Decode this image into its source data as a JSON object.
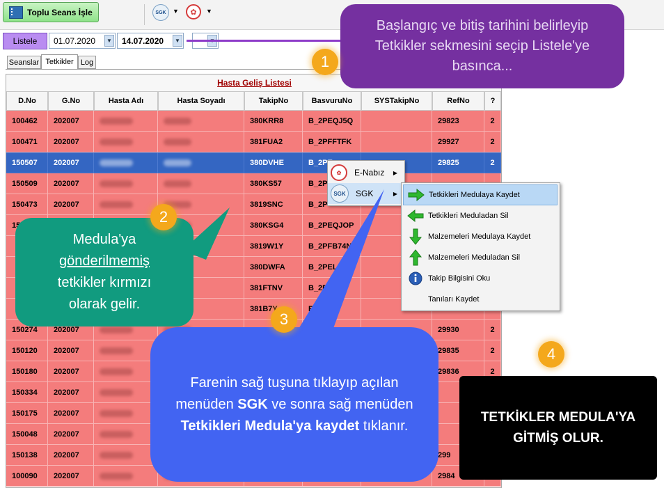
{
  "toolbar": {
    "toplu_label": "Toplu Seans İşle",
    "sgk_icon_text": "SGK"
  },
  "filter": {
    "list_button": "Listele",
    "start_date": "01.07.2020",
    "end_date": "14.07.2020"
  },
  "tabs": [
    {
      "label": "Seanslar",
      "active": false
    },
    {
      "label": "Tetkikler",
      "active": true
    },
    {
      "label": "Log",
      "active": false
    }
  ],
  "grid": {
    "title": "Hasta Geliş Listesi",
    "columns": [
      "D.No",
      "G.No",
      "Hasta Adı",
      "Hasta Soyadı",
      "TakipNo",
      "BasvuruNo",
      "SYSTakipNo",
      "RefNo",
      "?"
    ],
    "rows": [
      {
        "dno": "100462",
        "gno": "202007",
        "takip": "380KRR8",
        "basvuru": "B_2PEQJ5Q",
        "sys": "",
        "ref": "29823",
        "q": "2",
        "selected": false
      },
      {
        "dno": "100471",
        "gno": "202007",
        "takip": "381FUA2",
        "basvuru": "B_2PFFTFK",
        "sys": "",
        "ref": "29927",
        "q": "2",
        "selected": false
      },
      {
        "dno": "150507",
        "gno": "202007",
        "takip": "380DVHE",
        "basvuru": "B_2PE",
        "sys": "",
        "ref": "29825",
        "q": "2",
        "selected": true
      },
      {
        "dno": "150509",
        "gno": "202007",
        "takip": "380KS57",
        "basvuru": "B_2P",
        "sys": "",
        "ref": "",
        "q": "",
        "selected": false
      },
      {
        "dno": "150473",
        "gno": "202007",
        "takip": "3819SNC",
        "basvuru": "B_2P",
        "sys": "",
        "ref": "",
        "q": "",
        "selected": false
      },
      {
        "dno": "15",
        "gno": "",
        "takip": "380KSG4",
        "basvuru": "B_2PEQJOP",
        "sys": "",
        "ref": "",
        "q": "",
        "selected": false
      },
      {
        "dno": "",
        "gno": "",
        "takip": "3819W1Y",
        "basvuru": "B_2PFB74N",
        "sys": "",
        "ref": "",
        "q": "",
        "selected": false
      },
      {
        "dno": "",
        "gno": "",
        "takip": "380DWFA",
        "basvuru": "B_2PEL6T8",
        "sys": "",
        "ref": "",
        "q": "",
        "selected": false
      },
      {
        "dno": "",
        "gno": "",
        "takip": "381FTNV",
        "basvuru": "B_2PFFS",
        "sys": "",
        "ref": "",
        "q": "",
        "selected": false
      },
      {
        "dno": "",
        "gno": "",
        "takip": "381B7Y",
        "basvuru": "B_2PF",
        "sys": "",
        "ref": "",
        "q": "",
        "selected": false
      },
      {
        "dno": "150274",
        "gno": "202007",
        "takip": "",
        "basvuru": "",
        "sys": "",
        "ref": "29930",
        "q": "2",
        "selected": false
      },
      {
        "dno": "150120",
        "gno": "202007",
        "takip": "",
        "basvuru": "",
        "sys": "",
        "ref": "29835",
        "q": "2",
        "selected": false
      },
      {
        "dno": "150180",
        "gno": "202007",
        "takip": "",
        "basvuru": "",
        "sys": "",
        "ref": "29836",
        "q": "2",
        "selected": false
      },
      {
        "dno": "150334",
        "gno": "202007",
        "takip": "",
        "basvuru": "",
        "sys": "",
        "ref": "",
        "q": "",
        "selected": false
      },
      {
        "dno": "150175",
        "gno": "202007",
        "takip": "",
        "basvuru": "",
        "sys": "",
        "ref": "",
        "q": "",
        "selected": false
      },
      {
        "dno": "150048",
        "gno": "202007",
        "takip": "",
        "basvuru": "",
        "sys": "",
        "ref": "",
        "q": "",
        "selected": false
      },
      {
        "dno": "150138",
        "gno": "202007",
        "takip": "",
        "basvuru": "",
        "sys": "",
        "ref": "299",
        "q": "",
        "selected": false
      },
      {
        "dno": "100090",
        "gno": "202007",
        "takip": "",
        "basvuru": "",
        "sys": "",
        "ref": "2984",
        "q": "",
        "selected": false
      }
    ]
  },
  "context_menu": {
    "items": [
      {
        "label": "E-Nabız",
        "icon": "enabiz-icon"
      },
      {
        "label": "SGK",
        "icon": "sgk-icon"
      }
    ],
    "submenu": [
      {
        "label": "Tetkikleri Medulaya Kaydet",
        "icon": "green-right-arrow-icon",
        "color": "#2fb82f"
      },
      {
        "label": "Tetkikleri Meduladan Sil",
        "icon": "green-left-arrow-icon",
        "color": "#2fb82f"
      },
      {
        "label": "Malzemeleri Medulaya Kaydet",
        "icon": "green-down-arrow-icon",
        "color": "#2fb82f"
      },
      {
        "label": "Malzemeleri Meduladan Sil",
        "icon": "green-up-arrow-icon",
        "color": "#2fb82f"
      },
      {
        "label": "Takip Bilgisini Oku",
        "icon": "info-icon",
        "color": "#2b5fb7"
      },
      {
        "label": "Tanıları Kaydet",
        "icon": "",
        "color": ""
      }
    ]
  },
  "callouts": {
    "step1": {
      "number": "1",
      "text": "Başlangıç ve bitiş tarihini belirleyip Tetkikler sekmesini seçip Listele'ye basınca..."
    },
    "step2": {
      "number": "2",
      "line1": "Medula'ya",
      "line2": "gönderilmemiş",
      "line3": "tetkikler kırmızı",
      "line4": "olarak gelir."
    },
    "step3": {
      "number": "3",
      "p1": "Farenin sağ tuşuna tıklayıp açılan menüden ",
      "b1": "SGK",
      "p2": " ve sonra sağ menüden ",
      "b2": "Tetkikleri Medula'ya kaydet",
      "p3": " tıklanır."
    },
    "step4": {
      "number": "4",
      "line1": "TETKİKLER MEDULA'YA",
      "line2": "GİTMİŞ OLUR."
    }
  },
  "colors": {
    "unsent_row": "#f47c7c",
    "selected_row": "#3466c2",
    "callout1": "#7530a0",
    "callout2": "#119b7f",
    "callout3": "#4264f2",
    "badge": "#f4a81c"
  }
}
